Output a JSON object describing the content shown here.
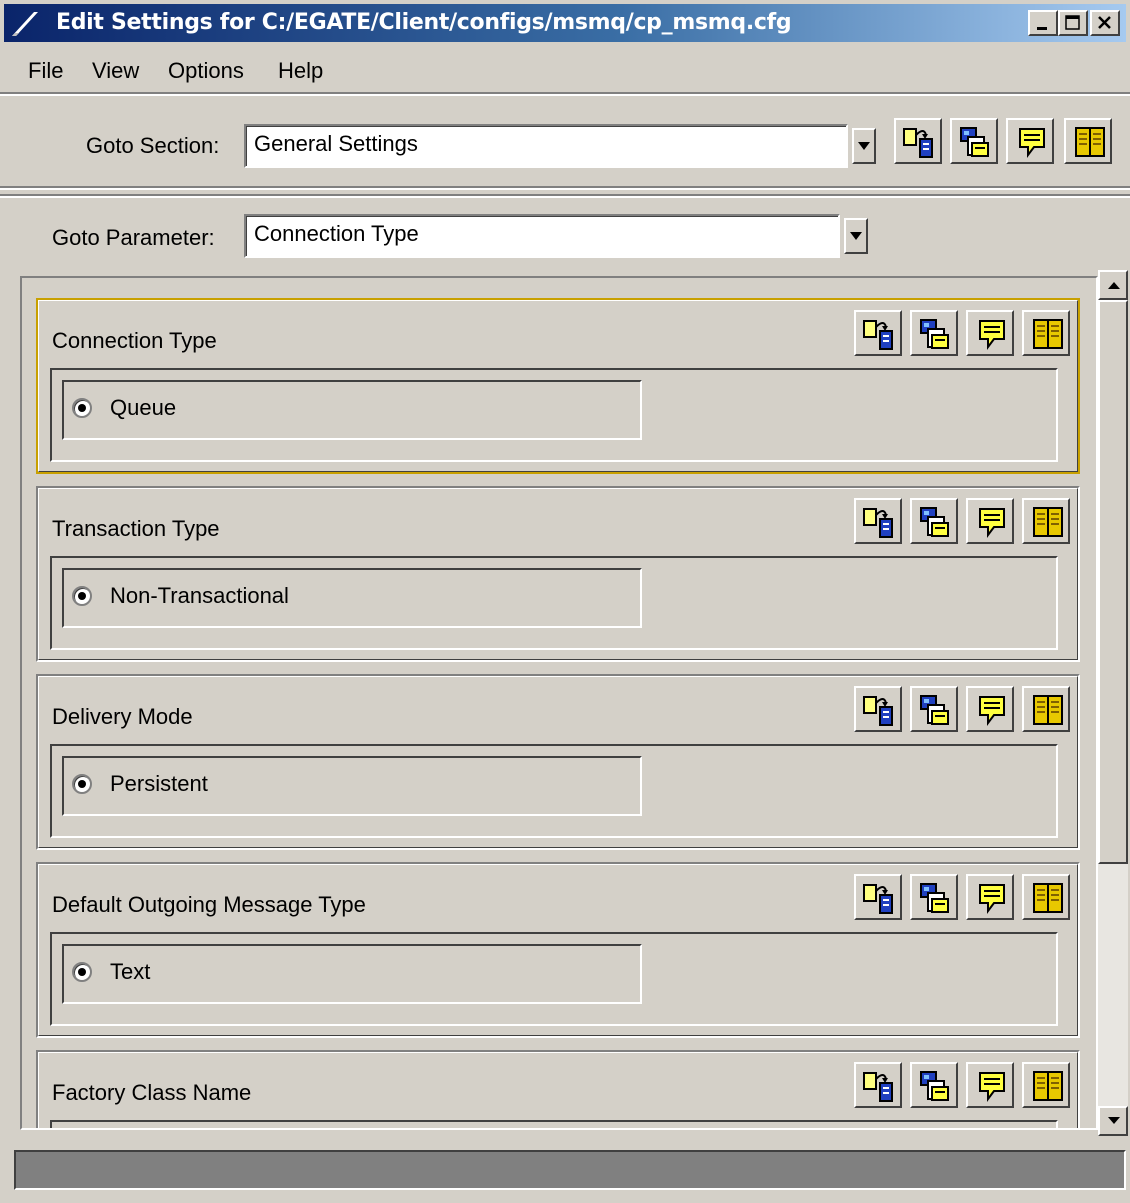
{
  "window": {
    "title": "Edit Settings for C:/EGATE/Client/configs/msmq/cp_msmq.cfg",
    "caption_buttons": [
      "minimize-icon",
      "maximize-icon",
      "close-icon"
    ]
  },
  "menu": {
    "file": "File",
    "view": "View",
    "options": "Options",
    "help": "Help"
  },
  "goto_section": {
    "label": "Goto Section:",
    "value": "General Settings"
  },
  "goto_parameter": {
    "label": "Goto Parameter:",
    "value": "Connection Type"
  },
  "toolbar_icons": [
    "copy-default-icon",
    "copy-paste-icon",
    "comment-icon",
    "help-book-icon"
  ],
  "parameters": [
    {
      "name": "Connection Type",
      "value": "Queue",
      "selected": true,
      "focused": true
    },
    {
      "name": "Transaction Type",
      "value": "Non-Transactional",
      "selected": true
    },
    {
      "name": "Delivery Mode",
      "value": "Persistent",
      "selected": true
    },
    {
      "name": "Default Outgoing Message Type",
      "value": "Text",
      "selected": true
    },
    {
      "name": "Factory Class Name"
    }
  ],
  "colors": {
    "face": "#d4d0c8",
    "title_start": "#0a246a",
    "title_end": "#a6caf0",
    "focus_border": "#c8a000"
  }
}
